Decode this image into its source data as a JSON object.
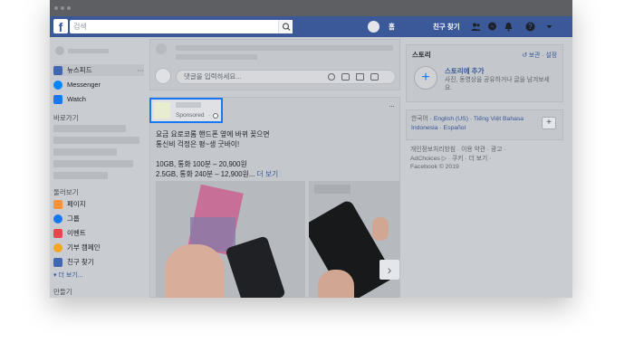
{
  "header": {
    "logo_letter": "f",
    "search_placeholder": "검색",
    "home_label": "홈",
    "find_friends_label": "친구 찾기"
  },
  "sidebar": {
    "items": [
      {
        "label": "뉴스피드",
        "icon": "newsfeed-icon",
        "more": "···"
      },
      {
        "label": "Messenger",
        "icon": "messenger-icon"
      },
      {
        "label": "Watch",
        "icon": "watch-icon"
      }
    ],
    "shortcuts_heading": "바로가기",
    "explore_heading": "둘러보기",
    "explore_items": [
      {
        "label": "페이지",
        "icon": "pages-icon"
      },
      {
        "label": "그룹",
        "icon": "groups-icon"
      },
      {
        "label": "이벤트",
        "icon": "events-icon"
      },
      {
        "label": "기부 캠페인",
        "icon": "fundraiser-icon"
      },
      {
        "label": "친구 찾기",
        "icon": "find-friends-icon"
      }
    ],
    "see_more": "▾ 더 보기...",
    "create_heading": "만들기"
  },
  "composer": {
    "placeholder": "댓글을 입력하세요..."
  },
  "post": {
    "sponsored": "Sponsored",
    "more": "···",
    "lines": [
      "요금 요로코롬 핸드폰 옆에 바뀌 꽂으면",
      "통신비 걱정은 평~생 굿바이!",
      "",
      "10GB, 통화 100분 – 20,900원",
      "2.5GB, 통화 240분 – 12,900원..."
    ],
    "see_more": "더 보기",
    "next_arrow": "›"
  },
  "stories": {
    "title": "스토리",
    "archive": "보관",
    "settings": "설정",
    "add_title": "스토리에 추가",
    "add_desc": "사진, 동영상을 공유하거나 글을 남겨보세요."
  },
  "languages": {
    "items": [
      "한국어",
      "English (US)",
      "Tiếng Việt",
      "Bahasa Indonesia",
      "Español"
    ],
    "add": "+"
  },
  "footer": {
    "links": [
      "개인정보처리방침",
      "이용 약관",
      "광고",
      "AdChoices ▷",
      "쿠키",
      "더 보기"
    ],
    "copyright": "Facebook © 2019"
  },
  "colors": {
    "brand": "#3b5998",
    "highlight": "#1877f2",
    "link": "#385898"
  }
}
